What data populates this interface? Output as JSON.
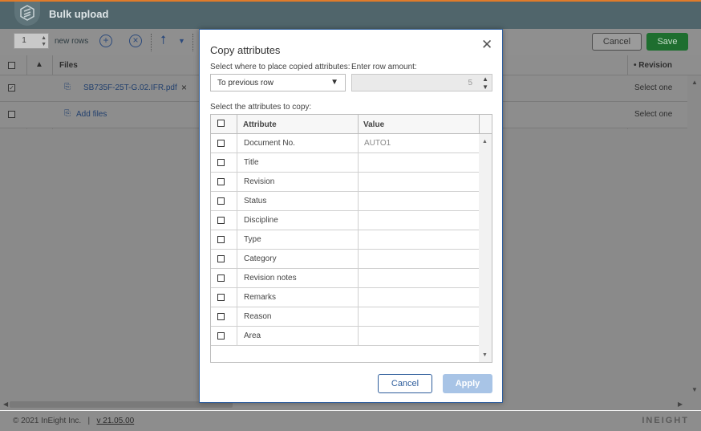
{
  "header": {
    "title": "Bulk upload",
    "logo_icon": "ineight-logo-icon"
  },
  "toolbar": {
    "row_count": "1",
    "new_rows_label": "new rows",
    "add_icon": "add-circle-icon",
    "clear_icon": "remove-circle-icon",
    "upload_icon": "upload-icon",
    "cancel_label": "Cancel",
    "save_label": "Save"
  },
  "grid": {
    "files_header": "Files",
    "revision_header": "• Revision",
    "rows": [
      {
        "file": "SB735F-25T-G.02.IFR.pdf",
        "revision": "Select one",
        "checked": true
      },
      {
        "file": "Add files",
        "revision": "Select one",
        "checked": false
      }
    ]
  },
  "footer": {
    "copyright": "© 2021 InEight Inc.",
    "separator": "|",
    "version": "v 21.05.00",
    "brand": "INEIGHT"
  },
  "modal": {
    "title": "Copy attributes",
    "place_label": "Select where to place copied attributes:",
    "place_value": "To previous row",
    "amount_label": "Enter row amount:",
    "amount_value": "5",
    "attrs_label": "Select the attributes to copy:",
    "col_attribute": "Attribute",
    "col_value": "Value",
    "rows": [
      {
        "attribute": "Document No.",
        "value": "AUTO1"
      },
      {
        "attribute": "Title",
        "value": ""
      },
      {
        "attribute": "Revision",
        "value": ""
      },
      {
        "attribute": "Status",
        "value": ""
      },
      {
        "attribute": "Discipline",
        "value": ""
      },
      {
        "attribute": "Type",
        "value": ""
      },
      {
        "attribute": "Category",
        "value": ""
      },
      {
        "attribute": "Revision notes",
        "value": ""
      },
      {
        "attribute": "Remarks",
        "value": ""
      },
      {
        "attribute": "Reason",
        "value": ""
      },
      {
        "attribute": "Area",
        "value": ""
      }
    ],
    "cancel_label": "Cancel",
    "apply_label": "Apply"
  },
  "colors": {
    "header_bg": "#50656b",
    "accent": "#2f5e9c",
    "save_bg": "#1e6e2f",
    "apply_bg": "#a8c4e6"
  }
}
